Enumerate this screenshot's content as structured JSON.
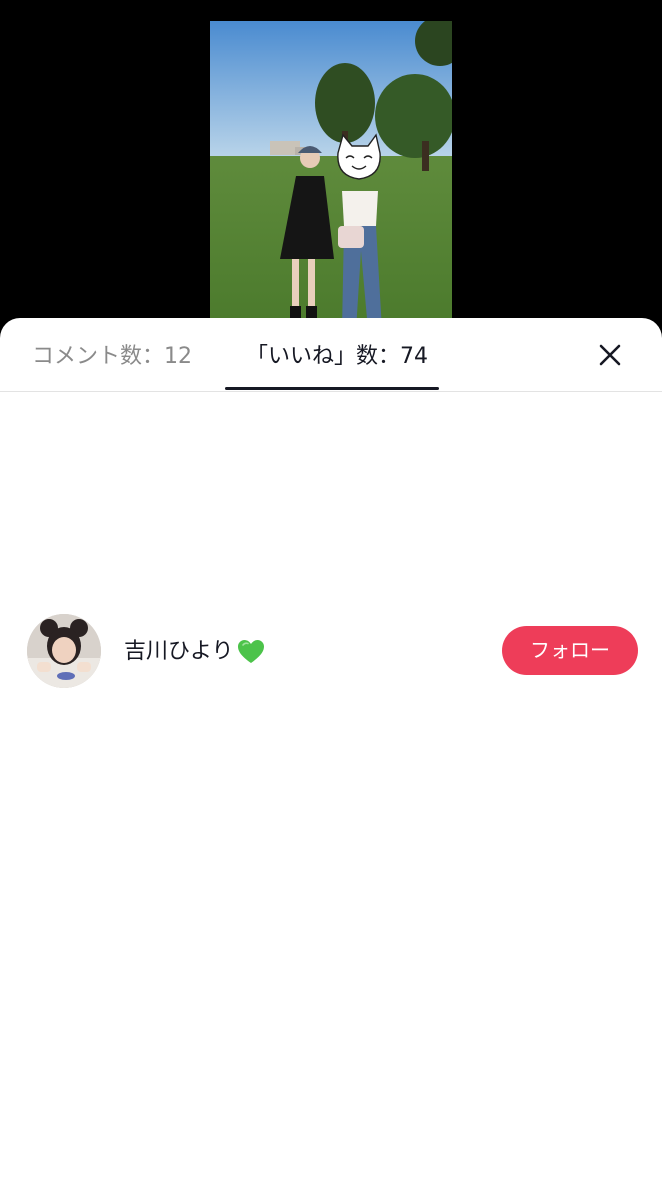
{
  "tabs": {
    "comments_label": "コメント数：12",
    "likes_label": "「いいね」数：74",
    "active": "likes"
  },
  "likes_list": [
    {
      "username": "吉川ひより",
      "badge_icon": "green-heart-icon",
      "follow_label": "フォロー"
    }
  ],
  "colors": {
    "follow_button": "#ee3d59",
    "active_tab_text": "#161823",
    "inactive_tab_text": "#8a8a8a",
    "heart": "#4cc34a"
  },
  "icons": {
    "close": "close-icon",
    "sticker": "cat-face-sticker-icon"
  }
}
